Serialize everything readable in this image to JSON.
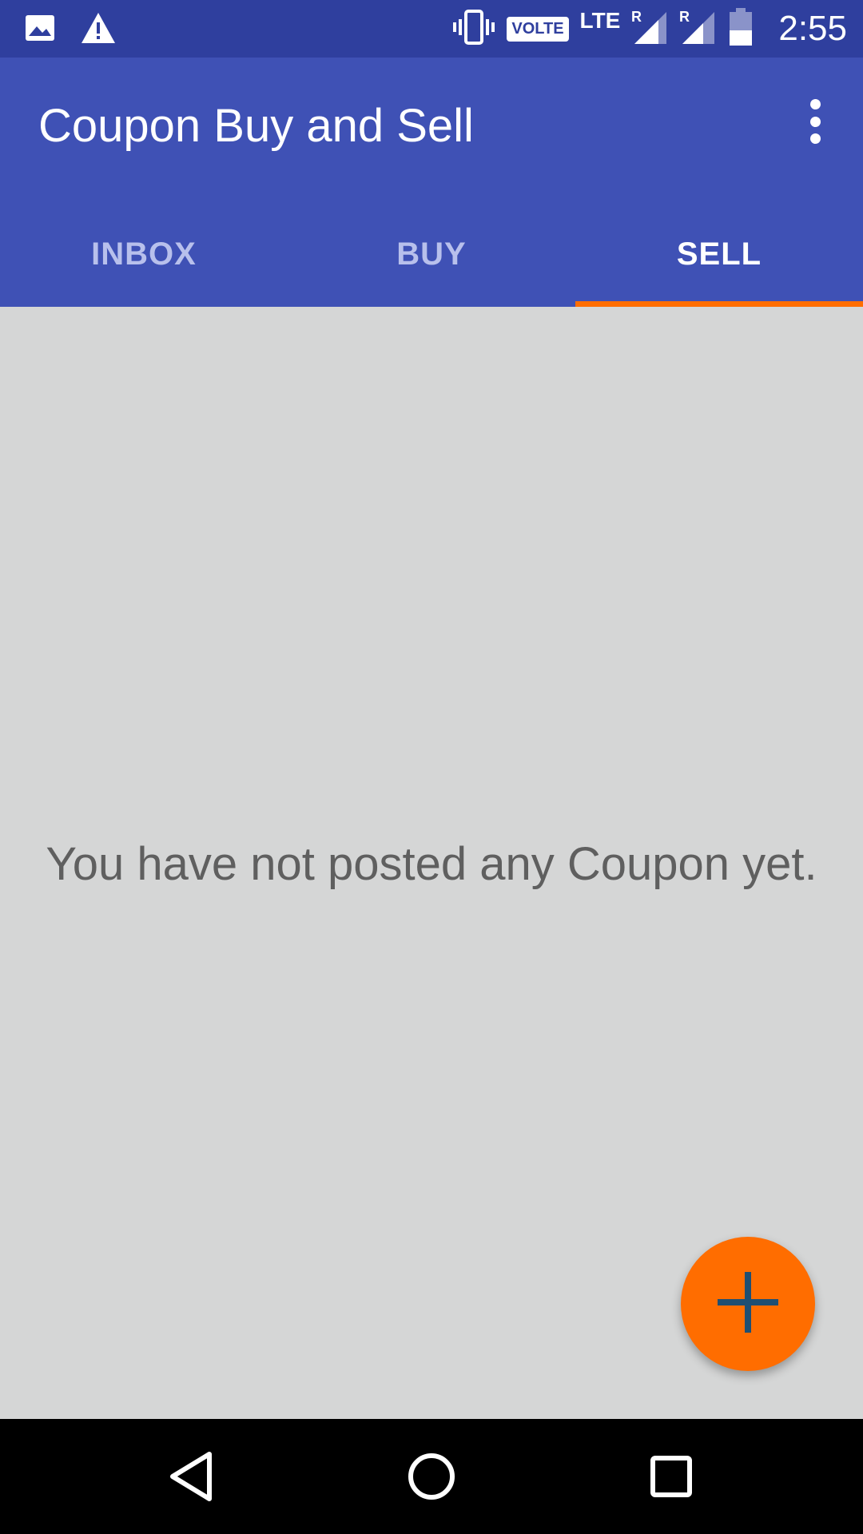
{
  "status_bar": {
    "time": "2:55",
    "volte_label": "VOLTE",
    "network_label": "LTE",
    "icons": [
      "image-icon",
      "warning-icon",
      "vibrate-icon",
      "signal-icon",
      "signal-icon",
      "battery-icon"
    ]
  },
  "app_bar": {
    "title": "Coupon Buy and Sell",
    "menu_icon": "overflow-menu-icon"
  },
  "tabs": [
    {
      "label": "INBOX",
      "active": false
    },
    {
      "label": "BUY",
      "active": false
    },
    {
      "label": "SELL",
      "active": true
    }
  ],
  "main": {
    "empty_message": "You have not posted any Coupon yet."
  },
  "fab": {
    "icon": "plus-icon"
  },
  "nav_bar": {
    "icons": [
      "back-icon",
      "home-icon",
      "recents-icon"
    ]
  },
  "colors": {
    "primary": "#3f51b5",
    "primary_dark": "#2f3f9e",
    "accent": "#ff6d00",
    "background": "#d5d6d6"
  }
}
